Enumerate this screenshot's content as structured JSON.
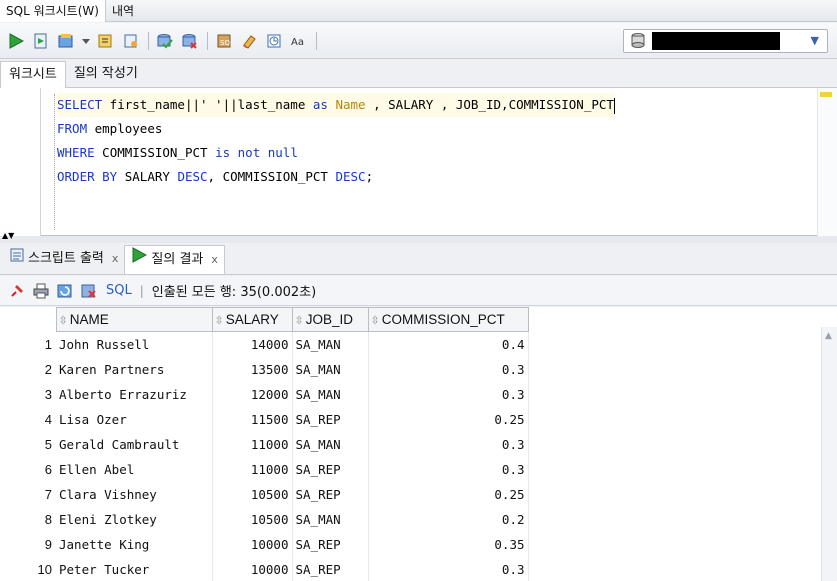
{
  "top_tabs": [
    "SQL 워크시트(W)",
    "내역"
  ],
  "worksheet_tabs": [
    "워크시트",
    "질의 작성기"
  ],
  "editor": {
    "lines": [
      "SELECT first_name||' '||last_name as Name , SALARY , JOB_ID,COMMISSION_PCT",
      "FROM employees",
      "WHERE COMMISSION_PCT is not null",
      "ORDER BY SALARY DESC, COMMISSION_PCT DESC;"
    ],
    "line1": {
      "kw_select": "SELECT",
      "t1": " first_name||' '||last_name ",
      "kw_as": "as",
      "alias": " Name",
      "t2": " , SALARY , JOB_ID,COMMISSION_PCT"
    },
    "line2": {
      "kw": "FROM",
      "rest": " employees"
    },
    "line3": {
      "kw1": "WHERE",
      "mid": " COMMISSION_PCT ",
      "kw2": "is not null"
    },
    "line4": {
      "kw1": "ORDER BY",
      "mid1": " SALARY ",
      "kw2": "DESC",
      "mid2": ", COMMISSION_PCT ",
      "kw3": "DESC",
      "end": ";"
    }
  },
  "result_tabs": [
    {
      "label": "스크립트 출력",
      "close": "x"
    },
    {
      "label": "질의 결과",
      "close": "x"
    }
  ],
  "result_toolbar": {
    "sql_link": "SQL",
    "separator": "|",
    "fetch_status": "인출된 모든 행: 35(0.002초)"
  },
  "grid": {
    "columns": [
      "NAME",
      "SALARY",
      "JOB_ID",
      "COMMISSION_PCT"
    ],
    "rows": [
      {
        "n": "1",
        "name": "John Russell",
        "salary": "14000",
        "job": "SA_MAN",
        "comm": "0.4"
      },
      {
        "n": "2",
        "name": "Karen Partners",
        "salary": "13500",
        "job": "SA_MAN",
        "comm": "0.3"
      },
      {
        "n": "3",
        "name": "Alberto Errazuriz",
        "salary": "12000",
        "job": "SA_MAN",
        "comm": "0.3"
      },
      {
        "n": "4",
        "name": "Lisa Ozer",
        "salary": "11500",
        "job": "SA_REP",
        "comm": "0.25"
      },
      {
        "n": "5",
        "name": "Gerald Cambrault",
        "salary": "11000",
        "job": "SA_MAN",
        "comm": "0.3"
      },
      {
        "n": "6",
        "name": "Ellen Abel",
        "salary": "11000",
        "job": "SA_REP",
        "comm": "0.3"
      },
      {
        "n": "7",
        "name": "Clara Vishney",
        "salary": "10500",
        "job": "SA_REP",
        "comm": "0.25"
      },
      {
        "n": "8",
        "name": "Eleni Zlotkey",
        "salary": "10500",
        "job": "SA_MAN",
        "comm": "0.2"
      },
      {
        "n": "9",
        "name": "Janette King",
        "salary": "10000",
        "job": "SA_REP",
        "comm": "0.35"
      },
      {
        "n": "10",
        "name": "Peter Tucker",
        "salary": "10000",
        "job": "SA_REP",
        "comm": "0.3"
      }
    ]
  },
  "icons": {
    "run": "run-statement-icon",
    "script": "run-script-icon",
    "commit": "commit-icon",
    "rollback": "rollback-icon",
    "connection": "database-icon"
  },
  "colors": {
    "keyword": "#1a37c8",
    "alias": "#b8860b",
    "run_green": "#2fa33a",
    "link": "#2c5cc5"
  }
}
